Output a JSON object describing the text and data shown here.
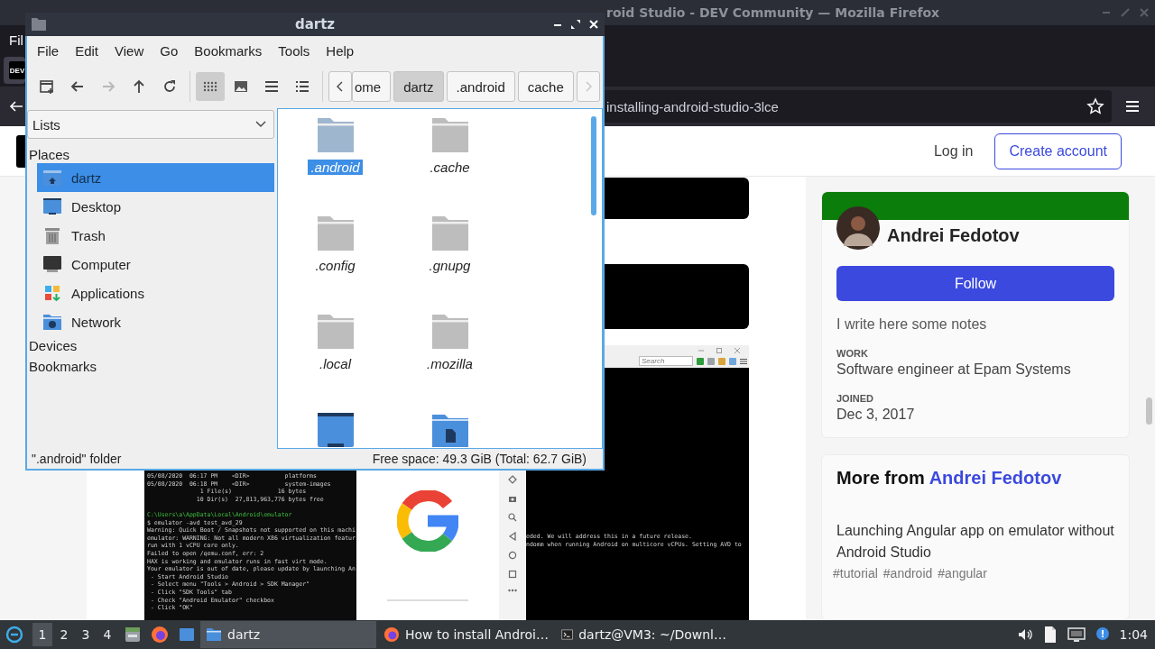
{
  "browser": {
    "title": "roid Studio - DEV Community — Mozilla Firefox",
    "menu": [
      "Fil"
    ],
    "tab": {
      "favicon": "DEV",
      "selected": true
    },
    "url": "installing-android-studio-3lce",
    "header": {
      "login": "Log in",
      "signup": "Create account"
    },
    "screenshot": {
      "search_placeholder": "Search",
      "terminal_lines": [
        {
          "kind": "output",
          "text": "05/08/2020  06:17 PM    <DIR>          platforms"
        },
        {
          "kind": "output",
          "text": "05/08/2020  06:18 PM    <DIR>          system-images"
        },
        {
          "kind": "output",
          "text": "               1 File(s)             16 bytes"
        },
        {
          "kind": "output",
          "text": "              10 Dir(s)  27,813,963,776 bytes free"
        },
        {
          "kind": "blank"
        },
        {
          "kind": "prompt",
          "text": "C:\\Users\\a\\AppData\\Local\\Android\\emulator"
        },
        {
          "kind": "output",
          "text": "$ emulator -avd test_avd_29"
        },
        {
          "kind": "output",
          "text": "Warning: Quick Boot / Snapshots not supported on this machi"
        },
        {
          "kind": "output",
          "text": "emulator: WARNING: Not all modern X86 virtualization featur"
        },
        {
          "kind": "output",
          "text": "run with 1 vCPU core only."
        },
        {
          "kind": "output",
          "text": "Failed to open /qemu.conf, err: 2"
        },
        {
          "kind": "output",
          "text": "HAX is working and emulator runs in fast virt mode."
        },
        {
          "kind": "output",
          "text": "Your emulator is out of date, please update by launching An"
        },
        {
          "kind": "output",
          "text": " - Start Android Studio"
        },
        {
          "kind": "output",
          "text": " - Select menu \"Tools > Android > SDK Manager\""
        },
        {
          "kind": "output",
          "text": " - Click \"SDK Tools\" tab"
        },
        {
          "kind": "output",
          "text": " - Check \"Android Emulator\" checkbox"
        },
        {
          "kind": "output",
          "text": " - Click \"OK\""
        }
      ],
      "console_lines": [
        "eded. We will address this in a future release.",
        "ndomm when running Android on multicore vCPUs. Setting AVD to"
      ]
    },
    "profile": {
      "name": "Andrei Fedotov",
      "follow": "Follow",
      "bio": "I write here some notes",
      "fields": [
        {
          "label": "WORK",
          "value": "Software engineer at Epam Systems"
        },
        {
          "label": "JOINED",
          "value": "Dec 3, 2017"
        }
      ]
    },
    "more_from": {
      "prefix": "More from",
      "author": "Andrei Fedotov",
      "articles": [
        {
          "title": "Launching Angular app on emulator without Android Studio",
          "tags": [
            "#tutorial",
            "#android",
            "#angular"
          ]
        }
      ]
    }
  },
  "file_manager": {
    "title": "dartz",
    "menu": [
      "File",
      "Edit",
      "View",
      "Go",
      "Bookmarks",
      "Tools",
      "Help"
    ],
    "nav": [
      {
        "kind": "new-tab",
        "disabled": false
      },
      {
        "kind": "back",
        "disabled": false
      },
      {
        "kind": "forward",
        "disabled": true
      },
      {
        "kind": "up",
        "disabled": false
      },
      {
        "kind": "reload",
        "disabled": false
      }
    ],
    "views": [
      {
        "kind": "icons",
        "selected": true
      },
      {
        "kind": "thumbnails",
        "selected": false
      },
      {
        "kind": "compact",
        "selected": false
      },
      {
        "kind": "details",
        "selected": false
      }
    ],
    "path": [
      {
        "label": "ome",
        "selected": false
      },
      {
        "label": "dartz",
        "selected": true
      },
      {
        "label": ".android",
        "selected": false
      },
      {
        "label": "cache",
        "selected": false
      }
    ],
    "path_next_disabled": true,
    "pane_select": "Lists",
    "places_header": "Places",
    "places": [
      {
        "label": "dartz",
        "kind": "home",
        "selected": true
      },
      {
        "label": "Desktop",
        "kind": "desktop",
        "selected": false
      },
      {
        "label": "Trash",
        "kind": "trash",
        "selected": false
      },
      {
        "label": "Computer",
        "kind": "computer",
        "selected": false
      },
      {
        "label": "Applications",
        "kind": "applications",
        "selected": false
      },
      {
        "label": "Network",
        "kind": "network",
        "selected": false
      }
    ],
    "other_headers": [
      "Devices",
      "Bookmarks"
    ],
    "files": [
      {
        "name": ".android",
        "kind": "folder",
        "selected": true
      },
      {
        "name": ".cache",
        "kind": "folder",
        "selected": false
      },
      {
        "name": ".config",
        "kind": "folder",
        "selected": false
      },
      {
        "name": ".gnupg",
        "kind": "folder",
        "selected": false
      },
      {
        "name": ".local",
        "kind": "folder",
        "selected": false
      },
      {
        "name": ".mozilla",
        "kind": "folder",
        "selected": false
      },
      {
        "kind": "desktop"
      },
      {
        "kind": "documents"
      }
    ],
    "status_left": "\".android\" folder",
    "status_right": "Free space: 49.3 GiB (Total: 62.7 GiB)"
  },
  "taskbar": {
    "workspaces": [
      {
        "label": "1",
        "selected": true
      },
      {
        "label": "2",
        "selected": false
      },
      {
        "label": "3",
        "selected": false
      },
      {
        "label": "4",
        "selected": false
      }
    ],
    "launchers": [
      {
        "kind": "files"
      },
      {
        "kind": "browser"
      },
      {
        "kind": "desktop"
      }
    ],
    "tasks": [
      {
        "label": "dartz",
        "kind": "folder",
        "selected": true
      },
      {
        "label": "How to install Androi…",
        "kind": "browser",
        "selected": false
      },
      {
        "label": "dartz@VM3: ~/Downl…",
        "kind": "terminal",
        "selected": false
      }
    ],
    "tray": [
      {
        "kind": "volume"
      },
      {
        "kind": "clipboard"
      },
      {
        "kind": "display"
      },
      {
        "kind": "notification"
      }
    ],
    "clock": "1:04"
  }
}
